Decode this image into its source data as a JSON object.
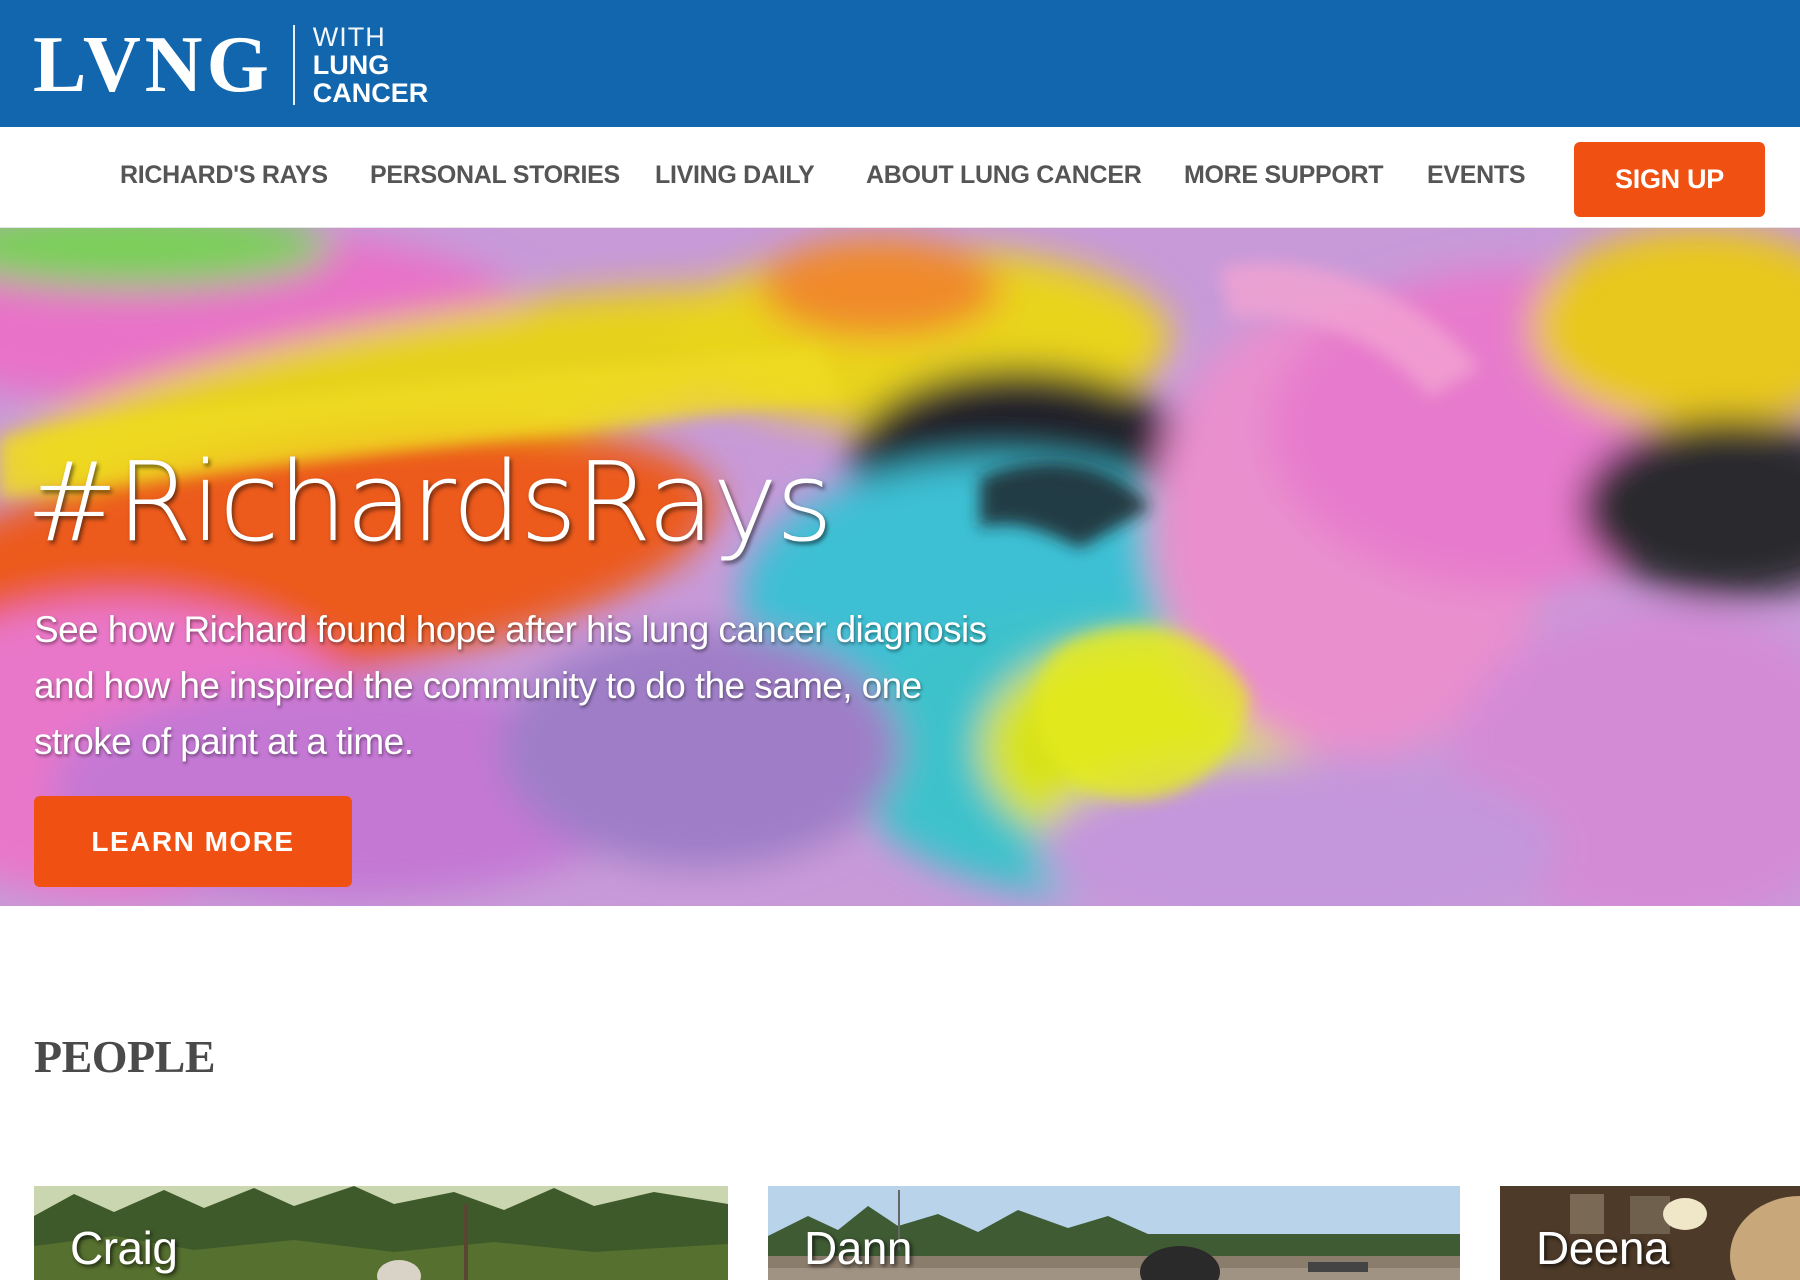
{
  "brand": {
    "logo_main": "LVNG",
    "logo_sub_1": "WITH",
    "logo_sub_2": "LUNG",
    "logo_sub_3": "CANCER",
    "bar_color": "#1266ae",
    "accent_color": "#f05011"
  },
  "nav": {
    "items": [
      {
        "label": "RICHARD'S RAYS"
      },
      {
        "label": "PERSONAL STORIES"
      },
      {
        "label": "LIVING DAILY"
      },
      {
        "label": "ABOUT LUNG CANCER"
      },
      {
        "label": "MORE SUPPORT"
      },
      {
        "label": "EVENTS"
      }
    ],
    "signup_label": "SIGN UP"
  },
  "hero": {
    "title": "#RichardsRays",
    "description": "See how Richard found hope after his lung cancer diagnosis and how he inspired the community to do the same, one stroke of paint at a time.",
    "cta_label": "LEARN MORE"
  },
  "people": {
    "heading": "PEOPLE",
    "cards": [
      {
        "name": "Craig"
      },
      {
        "name": "Dann"
      },
      {
        "name": "Deena"
      }
    ]
  }
}
